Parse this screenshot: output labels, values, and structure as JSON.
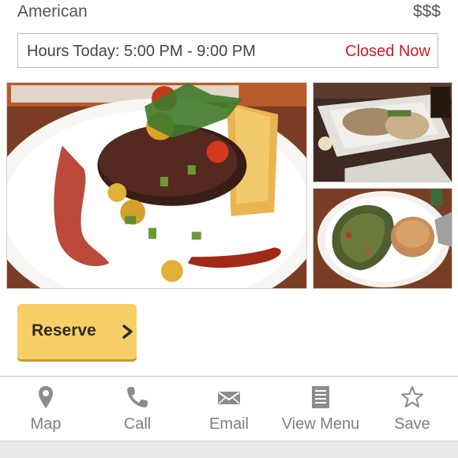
{
  "restaurant": {
    "cuisine": "American",
    "price": "$$$"
  },
  "hours": {
    "text": "Hours Today: 5:00 PM - 9:00 PM",
    "status": "Closed Now",
    "status_color": "#d0181f"
  },
  "photos": {
    "main_icon": "food-photo-steak",
    "top_icon": "food-photo-plates",
    "bottom_icon": "food-photo-salad"
  },
  "reserve": {
    "label": "Reserve",
    "color": "#f8cf67"
  },
  "toolbar": {
    "items": [
      {
        "label": "Map",
        "icon": "map-pin-icon"
      },
      {
        "label": "Call",
        "icon": "phone-icon"
      },
      {
        "label": "Email",
        "icon": "envelope-icon"
      },
      {
        "label": "View Menu",
        "icon": "menu-icon"
      },
      {
        "label": "Save",
        "icon": "star-icon"
      }
    ]
  }
}
